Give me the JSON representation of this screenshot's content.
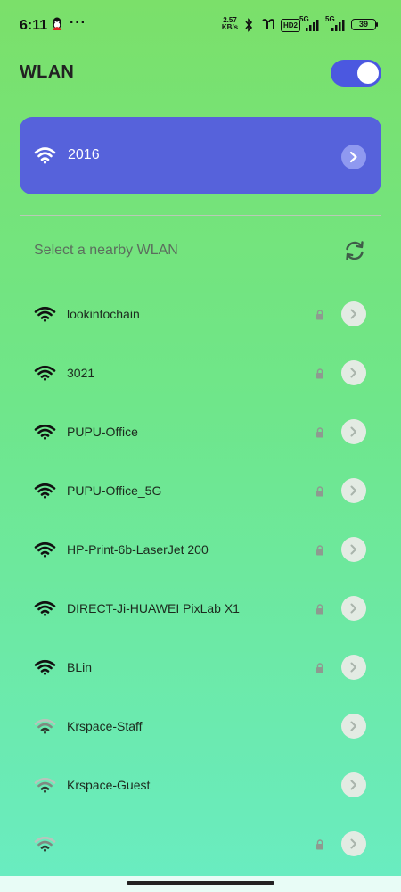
{
  "status_bar": {
    "time": "6:11",
    "more": "···",
    "net_speed_value": "2.57",
    "net_speed_unit": "KB/s",
    "hd_label": "HD2",
    "sim1_label": "5G",
    "sim2_label": "5G",
    "battery": "39",
    "battery_percent": 39
  },
  "header": {
    "title": "WLAN",
    "wlan_enabled": true
  },
  "connected": {
    "ssid": "2016"
  },
  "section_label": "Select a nearby WLAN",
  "networks": [
    {
      "ssid": "lookintochain",
      "locked": true,
      "strength": "strong"
    },
    {
      "ssid": "3021",
      "locked": true,
      "strength": "strong"
    },
    {
      "ssid": "PUPU-Office",
      "locked": true,
      "strength": "strong"
    },
    {
      "ssid": "PUPU-Office_5G",
      "locked": true,
      "strength": "strong"
    },
    {
      "ssid": "HP-Print-6b-LaserJet 200",
      "locked": true,
      "strength": "strong"
    },
    {
      "ssid": "DIRECT-Ji-HUAWEI PixLab X1",
      "locked": true,
      "strength": "strong"
    },
    {
      "ssid": "BLin",
      "locked": true,
      "strength": "strong"
    },
    {
      "ssid": "Krspace-Staff",
      "locked": false,
      "strength": "weak"
    },
    {
      "ssid": "Krspace-Guest",
      "locked": false,
      "strength": "weak"
    },
    {
      "ssid": "",
      "locked": true,
      "strength": "weak"
    }
  ],
  "colors": {
    "accent": "#5662db",
    "toggle_on": "#4b58e0"
  }
}
